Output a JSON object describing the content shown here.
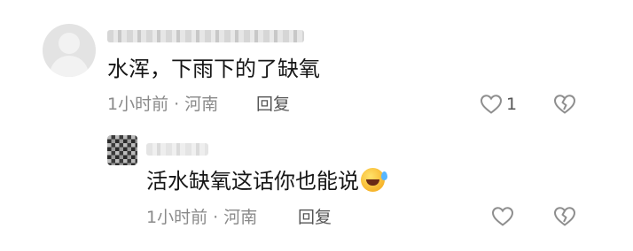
{
  "comment": {
    "text": "水浑，下雨下的了缺氧",
    "time": "1小时前 · 河南",
    "reply_label": "回复",
    "like_count": "1",
    "icons": [
      "heart-outline-icon",
      "broken-heart-icon"
    ]
  },
  "reply": {
    "text": "活水缺氧这话你也能说",
    "emoji": "rolling-laughing-emoji",
    "time": "1小时前 · 河南",
    "reply_label": "回复",
    "icons": [
      "heart-outline-icon",
      "broken-heart-icon"
    ]
  },
  "colors": {
    "text": "#161616",
    "meta": "#8a8a8a",
    "icon": "#8e8e8e",
    "background": "#ffffff"
  }
}
